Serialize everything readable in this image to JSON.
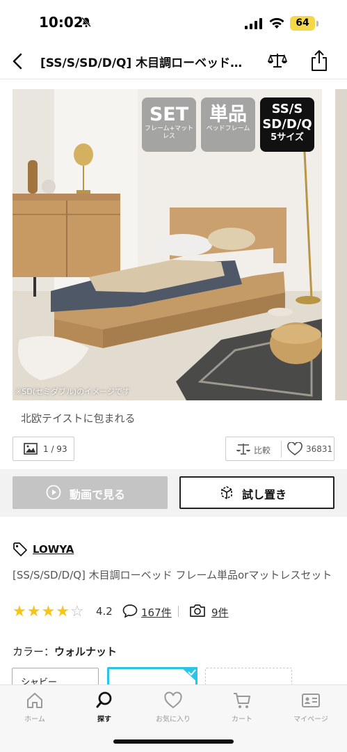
{
  "status": {
    "time": "10:02",
    "battery": "64"
  },
  "nav": {
    "title": "[SS/S/SD/D/Q] 木目調ローベッド…"
  },
  "hero": {
    "badges": {
      "set_big": "SET",
      "set_small": "フレーム+マットレス",
      "single_big": "単品",
      "single_small": "ベッドフレーム",
      "size_line1": "SS/S",
      "size_line2": "SD/D/Q",
      "size_line3": "5サイズ"
    },
    "note": "※SD(セミダブル)のイメージです"
  },
  "caption": "北欧テイストに包まれる",
  "gallery": {
    "counter": "1 / 93"
  },
  "compare_label": "比較",
  "like_count": "36831",
  "video_button": "動画で見る",
  "ar_button": "試し置き",
  "brand": "LOWYA",
  "product_name": "[SS/S/SD/D/Q] 木目調ローベッド フレーム単品orマットレスセット",
  "rating": {
    "value": "4.2",
    "stars": 4.2,
    "review_count": "167件",
    "photo_count": "9件"
  },
  "color": {
    "label": "カラー：",
    "selected": "ウォルナット",
    "options": [
      "シャビー"
    ]
  },
  "tabs": [
    {
      "label": "ホーム"
    },
    {
      "label": "探す"
    },
    {
      "label": "お気に入り"
    },
    {
      "label": "カート"
    },
    {
      "label": "マイページ"
    }
  ],
  "colors": {
    "accent_cyan": "#29c4e6",
    "star": "#f5c518"
  }
}
